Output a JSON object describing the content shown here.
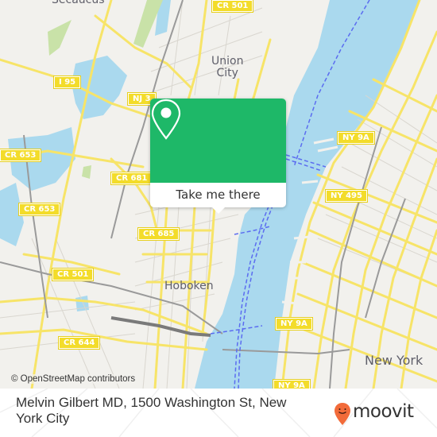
{
  "map": {
    "attribution": "© OpenStreetMap contributors",
    "place_labels": [
      {
        "id": "secaucus",
        "text": "Secaucus"
      },
      {
        "id": "union-city",
        "text": "Union\nCity"
      },
      {
        "id": "hoboken",
        "text": "Hoboken"
      },
      {
        "id": "new-york",
        "text": "New York"
      }
    ],
    "road_shields": [
      {
        "id": "cr-501-top",
        "text": "CR 501"
      },
      {
        "id": "i-95",
        "text": "I 95"
      },
      {
        "id": "nj-3",
        "text": "NJ 3"
      },
      {
        "id": "ny-9a-top",
        "text": "NY 9A"
      },
      {
        "id": "cr-653-a",
        "text": "CR 653"
      },
      {
        "id": "cr-681",
        "text": "CR 681"
      },
      {
        "id": "ny-495",
        "text": "NY 495"
      },
      {
        "id": "cr-653-b",
        "text": "CR 653"
      },
      {
        "id": "cr-685",
        "text": "CR 685"
      },
      {
        "id": "cr-501",
        "text": "CR 501"
      },
      {
        "id": "ny-9a-mid",
        "text": "NY 9A"
      },
      {
        "id": "cr-644",
        "text": "CR 644"
      },
      {
        "id": "ny-9a-bottom",
        "text": "NY 9A"
      }
    ],
    "colors": {
      "land": "#f2f1ed",
      "water": "#aad9ee",
      "major_road": "#f7e468",
      "ferry": "#5b6cf0",
      "park": "#c9e2a8"
    }
  },
  "popup": {
    "icon": "map-pin-icon",
    "button_label": "Take me there",
    "color": "#1eb868"
  },
  "footer": {
    "address": "Melvin Gilbert MD, 1500 Washington St, New York City",
    "brand": "moovit",
    "brand_icon": "moovit-smiley-pin-icon",
    "brand_color": "#f26b3a"
  }
}
